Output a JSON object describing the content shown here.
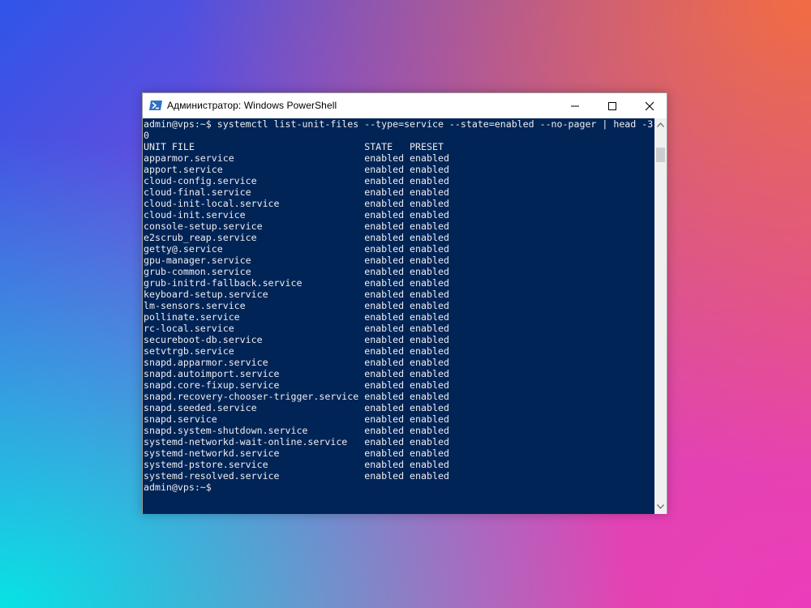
{
  "window": {
    "title": "Администратор: Windows PowerShell",
    "icon": "powershell-icon",
    "controls": {
      "minimize": "minimize-icon",
      "maximize": "maximize-icon",
      "close": "close-icon"
    }
  },
  "console": {
    "lines": [
      "admin@vps:~$ systemctl list-unit-files --type=service --state=enabled --no-pager | head -3",
      "0",
      "UNIT FILE                              STATE   PRESET",
      "apparmor.service                       enabled enabled",
      "apport.service                         enabled enabled",
      "cloud-config.service                   enabled enabled",
      "cloud-final.service                    enabled enabled",
      "cloud-init-local.service               enabled enabled",
      "cloud-init.service                     enabled enabled",
      "console-setup.service                  enabled enabled",
      "e2scrub_reap.service                   enabled enabled",
      "getty@.service                         enabled enabled",
      "gpu-manager.service                    enabled enabled",
      "grub-common.service                    enabled enabled",
      "grub-initrd-fallback.service           enabled enabled",
      "keyboard-setup.service                 enabled enabled",
      "lm-sensors.service                     enabled enabled",
      "pollinate.service                      enabled enabled",
      "rc-local.service                       enabled enabled",
      "secureboot-db.service                  enabled enabled",
      "setvtrgb.service                       enabled enabled",
      "snapd.apparmor.service                 enabled enabled",
      "snapd.autoimport.service               enabled enabled",
      "snapd.core-fixup.service               enabled enabled",
      "snapd.recovery-chooser-trigger.service enabled enabled",
      "snapd.seeded.service                   enabled enabled",
      "snapd.service                          enabled enabled",
      "snapd.system-shutdown.service          enabled enabled",
      "systemd-networkd-wait-online.service   enabled enabled",
      "systemd-networkd.service               enabled enabled",
      "systemd-pstore.service                 enabled enabled",
      "systemd-resolved.service               enabled enabled",
      "admin@vps:~$"
    ]
  },
  "colors": {
    "console_bg": "#012456",
    "console_fg": "#eeedf0",
    "titlebar_bg": "#ffffff"
  }
}
